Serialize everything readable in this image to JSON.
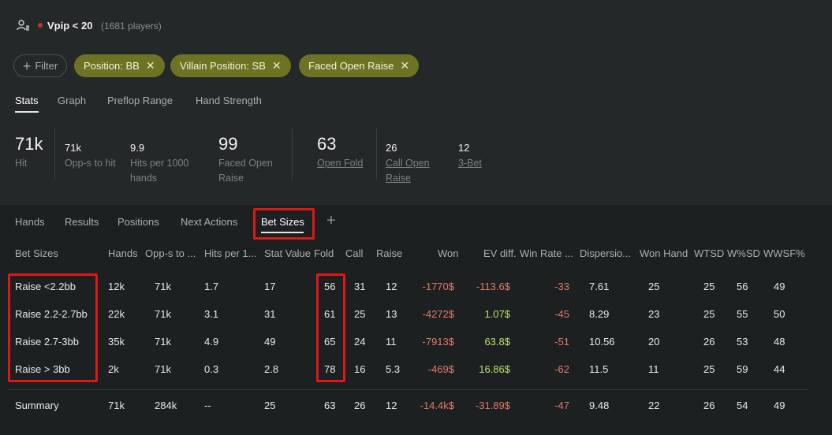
{
  "segment": {
    "icon": "user-group-icon",
    "dot_color": "#c0392b",
    "name": "Vpip < 20",
    "count": "(1681 players)"
  },
  "filters": {
    "add_label": "Filter",
    "chips": [
      {
        "label": "Position: BB"
      },
      {
        "label": "Villain Position: SB"
      },
      {
        "label": "Faced Open Raise"
      }
    ]
  },
  "main_tabs": [
    {
      "label": "Stats",
      "active": true
    },
    {
      "label": "Graph"
    },
    {
      "label": "Preflop Range"
    },
    {
      "label": "Hand Strength"
    }
  ],
  "stats": {
    "hit": {
      "value": "71k",
      "label": "Hit"
    },
    "opps_to_hit": {
      "value": "71k",
      "label": "Opp-s to hit"
    },
    "hits_per_1000": {
      "value": "9.9",
      "label1": "Hits per 1000",
      "label2": "hands"
    },
    "faced_open": {
      "value": "99",
      "label1": "Faced Open",
      "label2": "Raise"
    },
    "open_fold": {
      "value": "63",
      "label": "Open Fold"
    },
    "call_open": {
      "value": "26",
      "label1": "Call Open",
      "label2": "Raise"
    },
    "three_bet": {
      "value": "12",
      "label": "3-Bet"
    }
  },
  "sub_tabs": [
    {
      "label": "Hands"
    },
    {
      "label": "Results"
    },
    {
      "label": "Positions"
    },
    {
      "label": "Next Actions"
    },
    {
      "label": "Bet Sizes",
      "active": true
    }
  ],
  "add_tab": "+",
  "table": {
    "headers": [
      "Bet Sizes",
      "Hands",
      "Opp-s to ...",
      "Hits per 1...",
      "Stat Value",
      "Fold",
      "Call",
      "Raise",
      "Won",
      "EV diff.",
      "Win Rate ...",
      "Dispersio...",
      "Won Hand",
      "WTSD",
      "W%SD",
      "WWSF%"
    ],
    "rows": [
      [
        "Raise <2.2bb",
        "12k",
        "71k",
        "1.7",
        "17",
        "56",
        "31",
        "12",
        "-1770$",
        "-113.6$",
        "-33",
        "7.61",
        "25",
        "25",
        "56",
        "49"
      ],
      [
        "Raise 2.2-2.7bb",
        "22k",
        "71k",
        "3.1",
        "31",
        "61",
        "25",
        "13",
        "-4272$",
        "1.07$",
        "-45",
        "8.29",
        "23",
        "25",
        "55",
        "50"
      ],
      [
        "Raise 2.7-3bb",
        "35k",
        "71k",
        "4.9",
        "49",
        "65",
        "24",
        "11",
        "-7913$",
        "63.8$",
        "-51",
        "10.56",
        "20",
        "26",
        "53",
        "48"
      ],
      [
        "Raise > 3bb",
        "2k",
        "71k",
        "0.3",
        "2.8",
        "78",
        "16",
        "5.3",
        "-469$",
        "16.86$",
        "-62",
        "11.5",
        "11",
        "25",
        "59",
        "44"
      ]
    ],
    "summary": [
      "Summary",
      "71k",
      "284k",
      "--",
      "25",
      "63",
      "26",
      "12",
      "-14.4k$",
      "-31.89$",
      "-47",
      "9.48",
      "22",
      "26",
      "54",
      "49"
    ]
  },
  "colors": {
    "chip": "#6e7223",
    "negative": "#e07a6a",
    "positive": "#b8e070",
    "highlight": "#e01717"
  }
}
